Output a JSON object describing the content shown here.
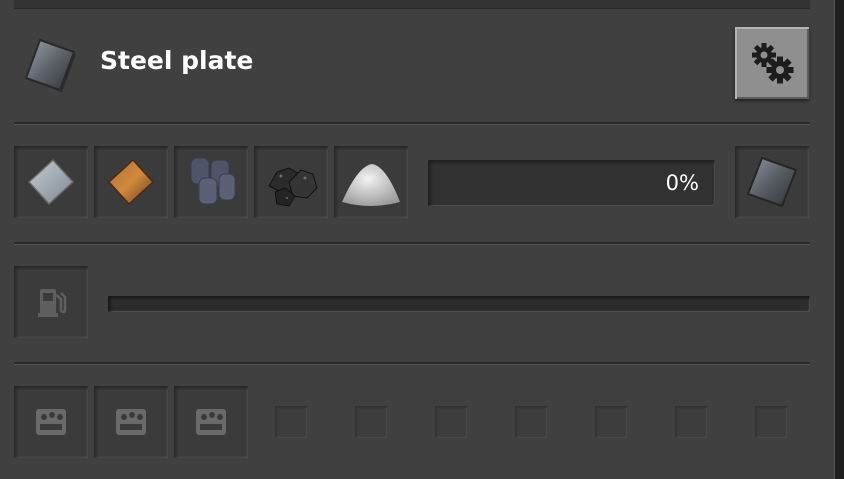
{
  "recipe": {
    "title": "Steel plate",
    "icon": "steel-plate-icon"
  },
  "settings_button": {
    "icon": "gears-icon"
  },
  "ingredients": [
    {
      "name": "iron-plate-icon"
    },
    {
      "name": "copper-plate-icon"
    },
    {
      "name": "tin-ingots-icon"
    },
    {
      "name": "coal-icon"
    },
    {
      "name": "stone-dust-icon"
    }
  ],
  "progress": {
    "value": 0,
    "text": "0%"
  },
  "result": {
    "icon": "steel-plate-icon"
  },
  "fuel": {
    "icon": "fuel-pump-icon",
    "level": 0
  },
  "modules": {
    "filled": 3,
    "total": 10,
    "icon": "module-icon"
  },
  "colors": {
    "panel": "#404040",
    "button": "#8f8f8f",
    "text": "#ffffff"
  }
}
